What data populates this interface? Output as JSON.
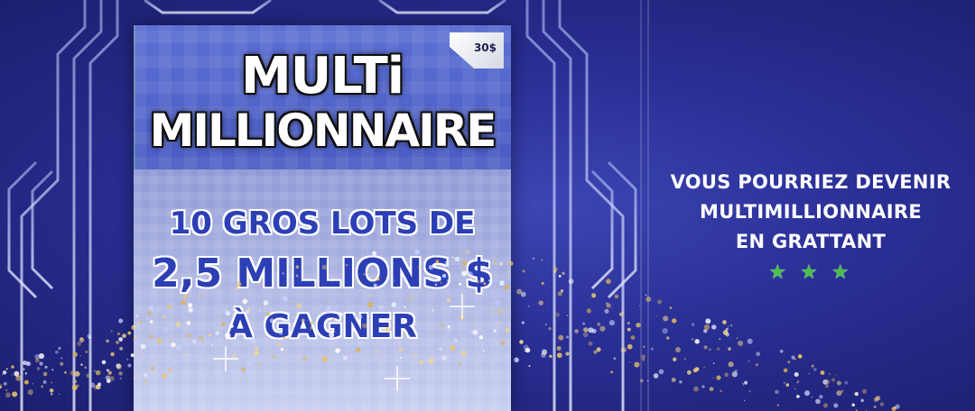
{
  "ticket": {
    "price": "30$",
    "logo_line1": "MULTi",
    "logo_line2": "MILLIONNAIRE",
    "prize_line1": "10 GROS LOTS DE",
    "prize_line2": "2,5 MILLIONS $",
    "prize_line3": "À GAGNER"
  },
  "tagline": {
    "line1": "VOUS POURRIEZ DEVENIR",
    "line2": "MULTIMILLIONNAIRE",
    "line3": "EN GRATTANT"
  },
  "stars": {
    "symbol": "★",
    "count": 3,
    "color": "#49c24a"
  },
  "colors": {
    "background": "#2a2f95",
    "prize_text": "#2c3fb5",
    "star": "#49c24a"
  }
}
